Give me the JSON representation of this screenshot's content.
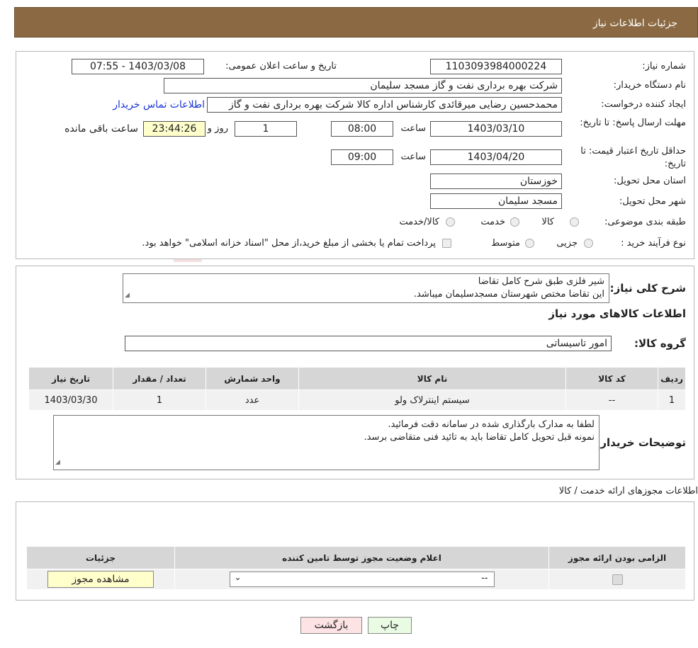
{
  "header": {
    "title": "جزئیات اطلاعات نیاز"
  },
  "watermark": {
    "text": "AriaTender.neT"
  },
  "info": {
    "need_number_label": "شماره نیاز:",
    "need_number": "1103093984000224",
    "announce_label": "تاریخ و ساعت اعلان عمومی:",
    "announce_value": "1403/03/08 - 07:55",
    "buyer_label": "نام دستگاه خریدار:",
    "buyer_value": "شرکت بهره برداری نفت و گاز مسجد سلیمان",
    "creator_label": "ایجاد کننده درخواست:",
    "creator_value": "محمدحسین رضایی میرقائدی کارشناس اداره کالا  شرکت بهره برداری نفت و گاز",
    "contact_link": "اطلاعات تماس خریدار",
    "deadline_label": "مهلت ارسال پاسخ: تا تاریخ:",
    "deadline_date": "1403/03/10",
    "time_label": "ساعت",
    "deadline_time": "08:00",
    "days_value": "1",
    "days_label": "روز و",
    "remaining_value": "23:44:26",
    "remaining_label": "ساعت باقی مانده",
    "validity_label": "حداقل تاریخ اعتبار قیمت: تا تاریخ:",
    "validity_date": "1403/04/20",
    "validity_time": "09:00",
    "province_label": "استان محل تحویل:",
    "province_value": "خوزستان",
    "city_label": "شهر محل تحویل:",
    "city_value": "مسجد سلیمان",
    "category_label": "طبقه بندی موضوعی:",
    "category_options": [
      "کالا",
      "خدمت",
      "کالا/خدمت"
    ],
    "process_label": "نوع فرآیند خرید :",
    "process_options": [
      "جزیی",
      "متوسط"
    ],
    "payment_note": "پرداخت تمام یا بخشی از مبلغ خرید،از محل \"اسناد خزانه اسلامی\" خواهد بود."
  },
  "description": {
    "label": "شرح کلی نیاز:",
    "line1": "شیر فلزی طبق شرح کامل تقاضا",
    "line2": "این تقاضا مختص شهرستان مسجدسلیمان میباشد."
  },
  "goods": {
    "section_title": "اطلاعات کالاهای مورد نیاز",
    "group_label": "گروه کالا:",
    "group_value": "امور تاسیساتی",
    "columns": [
      "ردیف",
      "کد کالا",
      "نام کالا",
      "واحد شمارش",
      "تعداد / مقدار",
      "تاریخ نیاز"
    ],
    "rows": [
      {
        "row": "1",
        "code": "--",
        "name": "سیستم اینترلاک ولو",
        "unit": "عدد",
        "qty": "1",
        "date": "1403/03/30"
      }
    ]
  },
  "buyer_notes": {
    "label": "توضیحات خریدار:",
    "line1": "لطفا به مدارک بارگذاری شده در سامانه دقت فرمائید.",
    "line2": "نمونه قبل تحویل کامل تقاضا باید به تائید فنی متقاضی برسد."
  },
  "permits": {
    "section_title": "اطلاعات مجوزهای ارائه خدمت / کالا",
    "columns": [
      "الزامی بودن ارائه مجوز",
      "اعلام وضعیت مجوز توسط تامین کننده",
      "جزئیات"
    ],
    "select_value": "--",
    "view_button": "مشاهده مجوز"
  },
  "footer": {
    "print": "چاپ",
    "back": "بازگشت"
  },
  "colors": {
    "header_bg": "#8b6a43",
    "yellow_field": "#ffffcc",
    "print_btn": "#e9fbe3",
    "back_btn": "#fde3e3",
    "link": "#1a35d6"
  }
}
